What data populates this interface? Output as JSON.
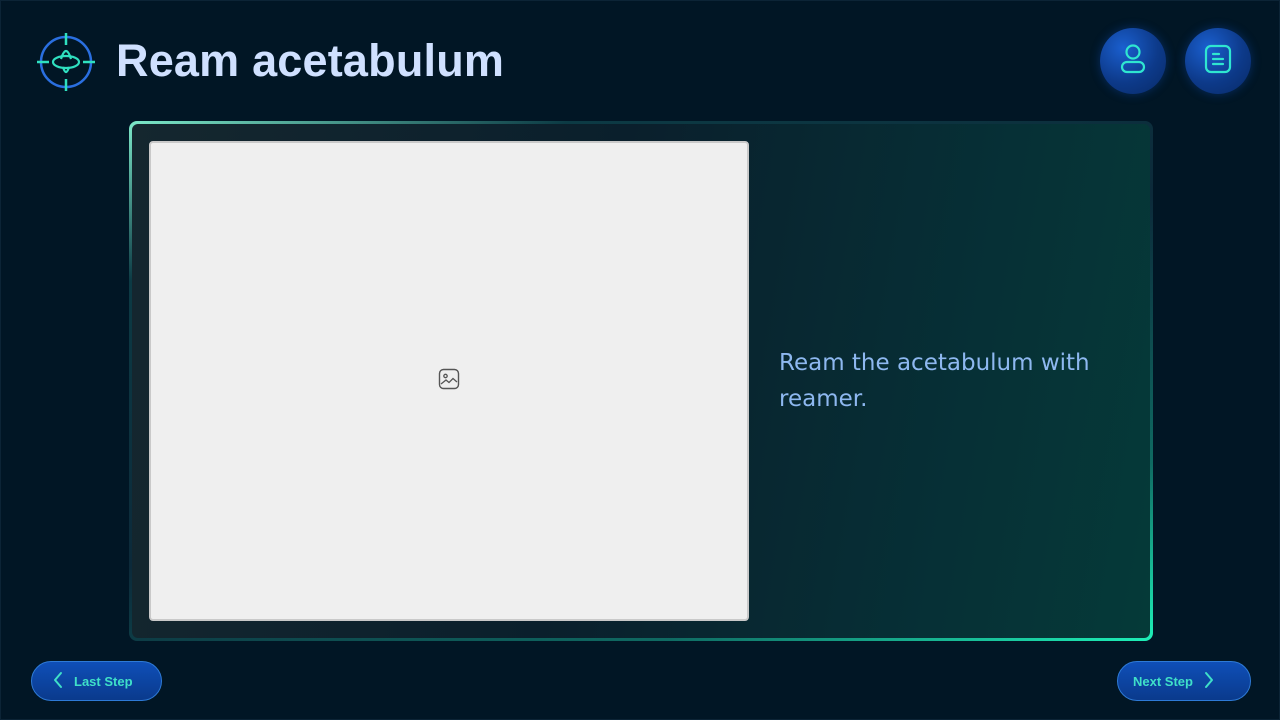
{
  "header": {
    "title": "Ream acetabulum",
    "logo_icon": "crosshair-target-icon",
    "user_button_icon": "user-icon",
    "doc_button_icon": "document-icon"
  },
  "step": {
    "image_icon": "image-placeholder-icon",
    "instruction": "Ream the acetabulum with reamer."
  },
  "navigation": {
    "prev_label": "Last Step",
    "next_label": "Next Step"
  },
  "colors": {
    "background": "#011625",
    "accent_teal": "#1ef0b8",
    "accent_blue": "#0f4fb8",
    "title_text": "#cfe0ff"
  }
}
